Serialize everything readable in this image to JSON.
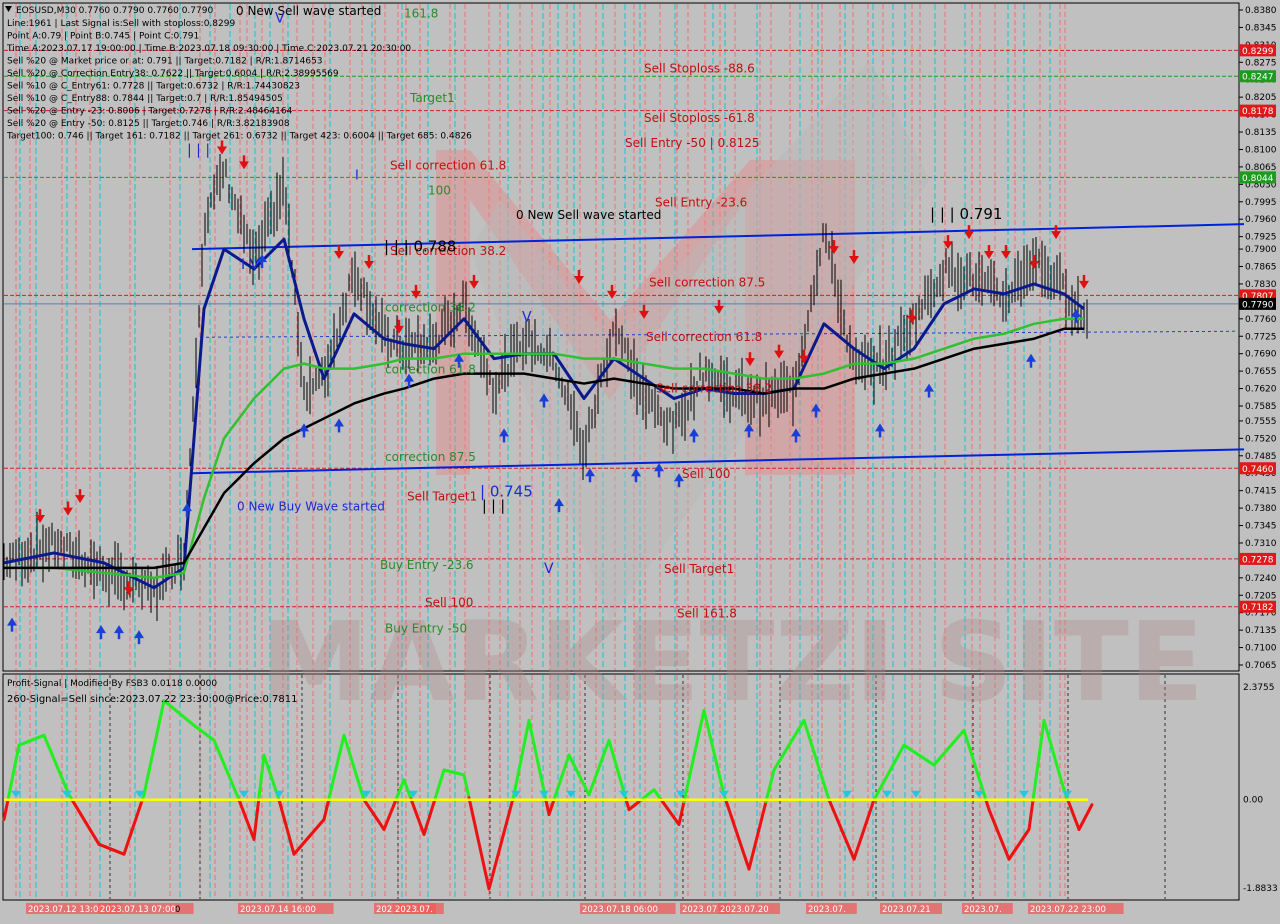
{
  "colors": {
    "background": "#c0c0c0",
    "panel_border": "#000000",
    "bull_arrow": "#1a3fd8",
    "bear_arrow": "#e01010",
    "ema_fast": "#0a1a8c",
    "ema_mid": "#30c030",
    "ema_slow": "#000000",
    "channel": "#0022dd",
    "vline_red": "#ff6060",
    "vline_cyan": "#00c8d8",
    "vline_dark": "#303030",
    "osc_green": "#22ee22",
    "osc_red": "#ee1111",
    "osc_zero": "#ffff00",
    "level_red_text": "#c01010",
    "level_green_text": "#2a8a2a",
    "watermark": "#b08a8a"
  },
  "info": {
    "symbol_line": "EOSUSD,M30  0.7760 0.7790 0.7760 0.7790",
    "lines": [
      "Line:1961 | Last Signal is:Sell with stoploss:0.8299",
      "Point A:0.79 | Point B:0.745 | Point C:0.791",
      "Time A:2023.07.17 19:00:00 | Time B:2023.07.18 09:30:00 | Time C:2023.07.21 20:30:00",
      "Sell %20 @ Market price or at: 0.791 || Target:0.7182 | R/R:1.8714653",
      "Sell %20 @ Correction Entry38: 0.7622 || Target:0.6004 | R/R:2.38995569",
      "Sell %10 @ C_Entry61: 0.7728 || Target:0.6732 | R/R:1.74430823",
      "Sell %10 @ C_Entry88: 0.7844 || Target:0.7 | R/R:1.85494505",
      "Sell %20 @ Entry -23: 0.8006 | Target:0.7278 | R/R:2.48464164",
      "Sell %20 @ Entry -50: 0.8125 || Target:0.746 | R/R:3.82183908",
      "Target100: 0.746 || Target 161: 0.7182 || Target 261: 0.6732 || Target 423: 0.6004 || Target 685: 0.4826"
    ]
  },
  "main_labels": [
    {
      "text": "0 New Sell wave started",
      "price": 0.837,
      "bar": 232,
      "color": "#000000"
    },
    {
      "text": "161.8",
      "price": 0.8365,
      "bar": 400,
      "color": "#2a8a2a"
    },
    {
      "text": "Sell Stoploss -88.6",
      "price": 0.8255,
      "bar": 640,
      "color": "#c01010"
    },
    {
      "text": "Target1",
      "price": 0.8195,
      "bar": 406,
      "color": "#2a8a2a"
    },
    {
      "text": "Sell Stoploss -61.8",
      "price": 0.8155,
      "bar": 640,
      "color": "#c01010"
    },
    {
      "text": "Sell Entry -50 | 0.8125",
      "price": 0.8105,
      "bar": 621,
      "color": "#c01010"
    },
    {
      "text": "Sell correction 61.8",
      "price": 0.806,
      "bar": 386,
      "color": "#c01010"
    },
    {
      "text": "100",
      "price": 0.801,
      "bar": 424,
      "color": "#2a8a2a"
    },
    {
      "text": "Sell Entry -23.6",
      "price": 0.7985,
      "bar": 651,
      "color": "#c01010"
    },
    {
      "text": "0 New Sell wave started",
      "price": 0.796,
      "bar": 512,
      "color": "#000000"
    },
    {
      "text": "Sell correction 38.2",
      "price": 0.7888,
      "bar": 386,
      "color": "#c01010"
    },
    {
      "text": "Sell correction 87.5",
      "price": 0.7825,
      "bar": 645,
      "color": "#c01010"
    },
    {
      "text": "correction 38.2",
      "price": 0.7775,
      "bar": 381,
      "color": "#2a8a2a"
    },
    {
      "text": "Sell correction 61.8",
      "price": 0.7715,
      "bar": 642,
      "color": "#c01010"
    },
    {
      "text": "correction 61.8",
      "price": 0.765,
      "bar": 381,
      "color": "#2a8a2a"
    },
    {
      "text": "Sell correction 38.2",
      "price": 0.7612,
      "bar": 652,
      "color": "#c01010"
    },
    {
      "text": "correction 87.5",
      "price": 0.7475,
      "bar": 381,
      "color": "#2a8a2a"
    },
    {
      "text": "Sell 100",
      "price": 0.744,
      "bar": 678,
      "color": "#c01010"
    },
    {
      "text": "Sell Target1",
      "price": 0.7395,
      "bar": 403,
      "color": "#c01010"
    },
    {
      "text": "0 New Buy Wave started",
      "price": 0.7375,
      "bar": 233,
      "color": "#1a2ad0"
    },
    {
      "text": "Buy Entry -23.6",
      "price": 0.7258,
      "bar": 376,
      "color": "#2a8a2a"
    },
    {
      "text": "Sell Target1",
      "price": 0.725,
      "bar": 660,
      "color": "#c01010"
    },
    {
      "text": "Sell 100",
      "price": 0.7182,
      "bar": 421,
      "color": "#c01010"
    },
    {
      "text": "Sell 161.8",
      "price": 0.716,
      "bar": 673,
      "color": "#c01010"
    },
    {
      "text": "Buy Entry -50",
      "price": 0.713,
      "bar": 381,
      "color": "#2a8a2a"
    }
  ],
  "wave_labels": [
    {
      "text": "| | | 0.788",
      "price": 0.7895,
      "bar": 380,
      "size": 15
    },
    {
      "text": "| | | 0.791",
      "price": 0.796,
      "bar": 926,
      "size": 15
    },
    {
      "text": "| 0.745",
      "price": 0.7403,
      "bar": 476,
      "size": 15
    },
    {
      "text": "| | |",
      "price": 0.7375,
      "bar": 478,
      "size": 14
    },
    {
      "text": "| | |",
      "price": 0.809,
      "bar": 183,
      "size": 14
    },
    {
      "text": "I V",
      "price": 0.786,
      "bar": 237,
      "size": 14
    },
    {
      "text": "V",
      "price": 0.8355,
      "bar": 271,
      "size": 14
    },
    {
      "text": "V",
      "price": 0.7755,
      "bar": 518,
      "size": 14
    },
    {
      "text": "V",
      "price": 0.725,
      "bar": 540,
      "size": 14
    },
    {
      "text": "I",
      "price": 0.804,
      "bar": 351,
      "size": 13
    }
  ],
  "price_axis": {
    "ticks": [
      "0.8380",
      "0.8345",
      "0.8310",
      "0.8275",
      "0.8240",
      "0.8205",
      "0.8170",
      "0.8135",
      "0.8100",
      "0.8065",
      "0.8030",
      "0.7995",
      "0.7960",
      "0.7925",
      "0.7900",
      "0.7865",
      "0.7830",
      "0.7795",
      "0.7760",
      "0.7725",
      "0.7690",
      "0.7655",
      "0.7620",
      "0.7585",
      "0.7555",
      "0.7520",
      "0.7485",
      "0.7450",
      "0.7415",
      "0.7380",
      "0.7345",
      "0.7310",
      "0.7275",
      "0.7240",
      "0.7205",
      "0.7170",
      "0.7135",
      "0.7100",
      "0.7065"
    ],
    "levels": [
      {
        "price": 0.8299,
        "label": "0.8299",
        "bg": "#e01818",
        "line": "#cc2222"
      },
      {
        "price": 0.8247,
        "label": "0.8247",
        "bg": "#1e9a1e",
        "line": "#1e9a1e"
      },
      {
        "price": 0.8178,
        "label": "0.8178",
        "bg": "#e01818",
        "line": "#cc2222"
      },
      {
        "price": 0.8044,
        "label": "0.8044",
        "bg": "#1e9a1e",
        "line": "#1e9a1e"
      },
      {
        "price": 0.7807,
        "label": "0.7807",
        "bg": "#e01818",
        "line": "#cc2222"
      },
      {
        "price": 0.779,
        "label": "0.7790",
        "bg": "#000000",
        "line": "#5a7fb0"
      },
      {
        "price": 0.746,
        "label": "0.7460",
        "bg": "#e01818",
        "line": "#cc2222"
      },
      {
        "price": 0.7278,
        "label": "0.7278",
        "bg": "#e01818",
        "line": "#cc2222"
      },
      {
        "price": 0.7182,
        "label": "0.7182",
        "bg": "#e01818",
        "line": "#cc2222"
      }
    ]
  },
  "oscillator": {
    "title": "Profit-Signal | Modified By FSB3 0.0118 0.0000",
    "signal_text": "260-Signal=Sell since:2023.07.22 23:30:00@Price:0.7811",
    "axis_ticks": [
      "2.3755",
      "0.00",
      "-1.8833"
    ]
  },
  "time_axis": {
    "labels": [
      "2023.07.12 13:00",
      "2023.07.13 07:00",
      "0",
      "2023.07.14 16:00",
      "2023.07.15",
      "2023.07.",
      "2023.07.18 06:00",
      "2023.07.",
      "2023.07.20",
      "2023.07.",
      "2023.07.21",
      "2023.07.",
      "2023.07.22 23:00"
    ]
  },
  "watermark_text": "MARKETZI SITE",
  "chart_data": {
    "type": "line",
    "title": "EOSUSD,M30",
    "ohlc_last": {
      "open": 0.776,
      "high": 0.779,
      "low": 0.776,
      "close": 0.779
    },
    "ylim": [
      0.7065,
      0.838
    ],
    "x": [
      0,
      50,
      100,
      150,
      180,
      200,
      220,
      250,
      280,
      300,
      320,
      350,
      380,
      400,
      430,
      460,
      490,
      520,
      550,
      580,
      610,
      640,
      670,
      700,
      730,
      760,
      790,
      820,
      850,
      880,
      910,
      940,
      970,
      1000,
      1030,
      1060,
      1080
    ],
    "series": [
      {
        "values": [
          0.727,
          0.731,
          0.725,
          0.721,
          0.729,
          0.795,
          0.806,
          0.787,
          0.803,
          0.762,
          0.764,
          0.786,
          0.772,
          0.77,
          0.771,
          0.779,
          0.762,
          0.772,
          0.768,
          0.749,
          0.775,
          0.76,
          0.754,
          0.766,
          0.761,
          0.76,
          0.762,
          0.794,
          0.766,
          0.767,
          0.776,
          0.786,
          0.784,
          0.78,
          0.788,
          0.782,
          0.776
        ]
      },
      {
        "values": [
          0.727,
          0.729,
          0.727,
          0.722,
          0.726,
          0.778,
          0.79,
          0.786,
          0.792,
          0.776,
          0.764,
          0.777,
          0.772,
          0.771,
          0.77,
          0.776,
          0.768,
          0.769,
          0.769,
          0.76,
          0.768,
          0.764,
          0.76,
          0.762,
          0.761,
          0.761,
          0.762,
          0.775,
          0.77,
          0.766,
          0.77,
          0.779,
          0.782,
          0.781,
          0.783,
          0.781,
          0.778
        ]
      },
      {
        "values": [
          0.726,
          0.726,
          0.725,
          0.724,
          0.725,
          0.74,
          0.752,
          0.76,
          0.766,
          0.767,
          0.766,
          0.766,
          0.767,
          0.768,
          0.768,
          0.769,
          0.769,
          0.769,
          0.769,
          0.768,
          0.768,
          0.767,
          0.766,
          0.766,
          0.765,
          0.764,
          0.764,
          0.765,
          0.767,
          0.767,
          0.768,
          0.77,
          0.772,
          0.773,
          0.775,
          0.776,
          0.776
        ]
      },
      {
        "values": [
          0.726,
          0.726,
          0.726,
          0.726,
          0.727,
          0.734,
          0.741,
          0.747,
          0.752,
          0.754,
          0.756,
          0.759,
          0.761,
          0.762,
          0.764,
          0.765,
          0.765,
          0.765,
          0.764,
          0.763,
          0.764,
          0.763,
          0.762,
          0.762,
          0.762,
          0.761,
          0.762,
          0.762,
          0.764,
          0.765,
          0.766,
          0.768,
          0.77,
          0.771,
          0.772,
          0.774,
          0.774
        ]
      }
    ],
    "channel_lines": [
      {
        "x": [
          188,
          1240
        ],
        "y": [
          0.79,
          0.795
        ]
      },
      {
        "x": [
          188,
          1240
        ],
        "y": [
          0.745,
          0.7498
        ]
      }
    ],
    "oscillator": {
      "ylim": [
        -1.8833,
        2.3755
      ],
      "x": [
        0,
        15,
        40,
        65,
        95,
        120,
        140,
        160,
        190,
        210,
        235,
        250,
        260,
        275,
        290,
        320,
        340,
        360,
        380,
        400,
        420,
        440,
        460,
        485,
        510,
        525,
        545,
        565,
        585,
        605,
        625,
        650,
        675,
        700,
        720,
        745,
        770,
        800,
        825,
        850,
        870,
        900,
        930,
        960,
        985,
        1005,
        1025,
        1040,
        1060,
        1075,
        1088
      ],
      "values": [
        -0.4,
        1.1,
        1.3,
        0.1,
        -0.9,
        -1.1,
        0.1,
        2.0,
        1.5,
        1.2,
        0.0,
        -0.8,
        0.9,
        0.0,
        -1.1,
        -0.4,
        1.3,
        0.0,
        -0.6,
        0.4,
        -0.7,
        0.6,
        0.5,
        -1.8,
        0.1,
        1.6,
        -0.3,
        0.9,
        0.1,
        1.2,
        -0.2,
        0.2,
        -0.5,
        1.8,
        0.1,
        -1.4,
        0.6,
        1.6,
        0.0,
        -1.2,
        0.0,
        1.1,
        0.7,
        1.4,
        -0.2,
        -1.2,
        -0.6,
        1.6,
        0.2,
        -0.6,
        -0.1
      ]
    }
  }
}
